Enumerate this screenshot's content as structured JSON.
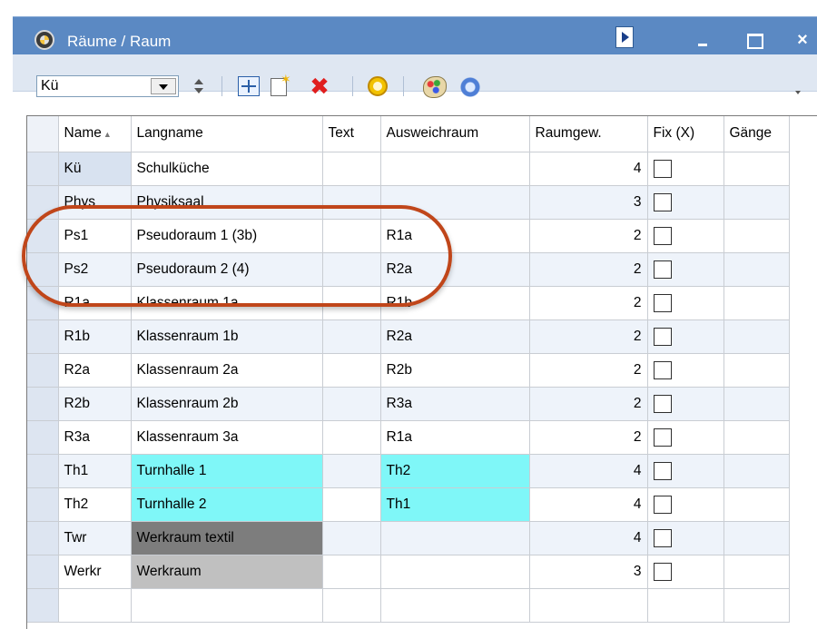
{
  "window": {
    "title": "Räume / Raum",
    "controls": {
      "minimize": "_",
      "maximize": "□",
      "close": "×"
    }
  },
  "toolbar": {
    "combo_value": "Kü",
    "icons": [
      "grid-settings-icon",
      "new-record-icon",
      "delete-icon",
      "clock-icon",
      "palette-icon",
      "sync-icon"
    ]
  },
  "grid": {
    "columns": [
      "Name",
      "Langname",
      "Text",
      "Ausweichraum",
      "Raumgew.",
      "Fix (X)",
      "Gänge"
    ],
    "sort_indicator": "▲",
    "rows": [
      {
        "name": "Kü",
        "langname": "Schulküche",
        "text": "",
        "ausweich": "",
        "raumgew": "4",
        "fix": false,
        "gaenge": "",
        "lang_color": "",
        "ausweich_color": ""
      },
      {
        "name": "Phys",
        "langname": "Physiksaal",
        "text": "",
        "ausweich": "",
        "raumgew": "3",
        "fix": false,
        "gaenge": "",
        "lang_color": "",
        "ausweich_color": ""
      },
      {
        "name": "Ps1",
        "langname": "Pseudoraum 1 (3b)",
        "text": "",
        "ausweich": "R1a",
        "raumgew": "2",
        "fix": false,
        "gaenge": "",
        "lang_color": "",
        "ausweich_color": ""
      },
      {
        "name": "Ps2",
        "langname": "Pseudoraum 2 (4)",
        "text": "",
        "ausweich": "R2a",
        "raumgew": "2",
        "fix": false,
        "gaenge": "",
        "lang_color": "",
        "ausweich_color": ""
      },
      {
        "name": "R1a",
        "langname": "Klassenraum 1a",
        "text": "",
        "ausweich": "R1b",
        "raumgew": "2",
        "fix": false,
        "gaenge": "",
        "lang_color": "",
        "ausweich_color": ""
      },
      {
        "name": "R1b",
        "langname": "Klassenraum 1b",
        "text": "",
        "ausweich": "R2a",
        "raumgew": "2",
        "fix": false,
        "gaenge": "",
        "lang_color": "",
        "ausweich_color": ""
      },
      {
        "name": "R2a",
        "langname": "Klassenraum 2a",
        "text": "",
        "ausweich": "R2b",
        "raumgew": "2",
        "fix": false,
        "gaenge": "",
        "lang_color": "",
        "ausweich_color": ""
      },
      {
        "name": "R2b",
        "langname": "Klassenraum 2b",
        "text": "",
        "ausweich": "R3a",
        "raumgew": "2",
        "fix": false,
        "gaenge": "",
        "lang_color": "",
        "ausweich_color": ""
      },
      {
        "name": "R3a",
        "langname": "Klassenraum 3a",
        "text": "",
        "ausweich": "R1a",
        "raumgew": "2",
        "fix": false,
        "gaenge": "",
        "lang_color": "",
        "ausweich_color": ""
      },
      {
        "name": "Th1",
        "langname": "Turnhalle 1",
        "text": "",
        "ausweich": "Th2",
        "raumgew": "4",
        "fix": false,
        "gaenge": "",
        "lang_color": "cyan",
        "ausweich_color": "cyan"
      },
      {
        "name": "Th2",
        "langname": "Turnhalle 2",
        "text": "",
        "ausweich": "Th1",
        "raumgew": "4",
        "fix": false,
        "gaenge": "",
        "lang_color": "cyan",
        "ausweich_color": "cyan"
      },
      {
        "name": "Twr",
        "langname": "Werkraum textil",
        "text": "",
        "ausweich": "",
        "raumgew": "4",
        "fix": false,
        "gaenge": "",
        "lang_color": "dark",
        "ausweich_color": ""
      },
      {
        "name": "Werkr",
        "langname": "Werkraum",
        "text": "",
        "ausweich": "",
        "raumgew": "3",
        "fix": false,
        "gaenge": "",
        "lang_color": "gray",
        "ausweich_color": ""
      }
    ]
  },
  "colors": {
    "titlebar": "#5b89c3",
    "highlight": "#c0461a",
    "cyan": "#7ff7f8",
    "dark": "#7d7d7d",
    "gray": "#c0c0c0"
  }
}
